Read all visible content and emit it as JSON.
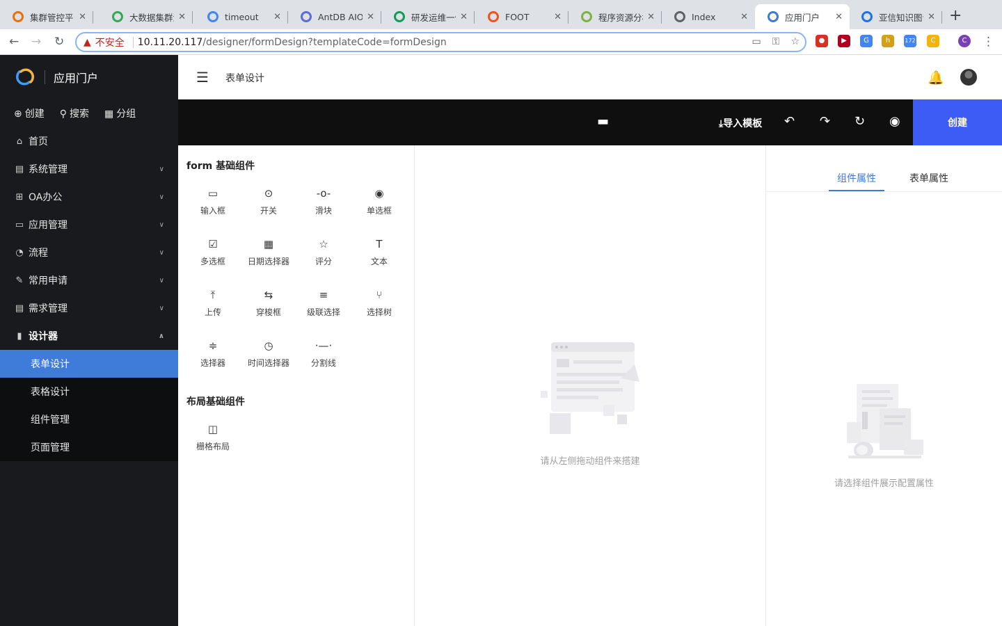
{
  "browser": {
    "tabs": [
      {
        "title": "集群管控平台",
        "color": "#e8710a"
      },
      {
        "title": "大数据集群滚",
        "color": "#34a853"
      },
      {
        "title": "timeout",
        "color": "#4285f4"
      },
      {
        "title": "AntDB AIOps",
        "color": "#5b6bd8"
      },
      {
        "title": "研发运维一体",
        "color": "#0f9d58"
      },
      {
        "title": "FOOT",
        "color": "#f4511e"
      },
      {
        "title": "程序资源分析",
        "color": "#7cb342"
      },
      {
        "title": "Index",
        "color": "#5f6368"
      },
      {
        "title": "应用门户",
        "color": "#3d7bd8"
      },
      {
        "title": "亚信知识图谱",
        "color": "#1a73e8"
      }
    ],
    "close_glyph": "✕",
    "newtab_glyph": "+",
    "insecure_label": "不安全",
    "url_host": "10.11.20.117",
    "url_path": "/designer/formDesign?templateCode=formDesign",
    "extensions": [
      {
        "name": "opera-ext-icon",
        "color": "#d93025",
        "text": "●"
      },
      {
        "name": "video-ext-icon",
        "color": "#b00020",
        "text": "▶"
      },
      {
        "name": "g-ext-icon",
        "color": "#4285f4",
        "text": "G"
      },
      {
        "name": "h-ext-icon",
        "color": "#d4a017",
        "text": "h"
      },
      {
        "name": "calendar-ext-icon",
        "color": "#4285f4",
        "text": "172"
      },
      {
        "name": "c-ext-icon",
        "color": "#f4b400",
        "text": "C"
      },
      {
        "name": "profile-ext-icon",
        "color": "#7b3fb8",
        "text": "C"
      }
    ]
  },
  "sidebar": {
    "brand": "应用门户",
    "quick": [
      {
        "icon": "plus-circle-icon",
        "glyph": "⊕",
        "label": "创建"
      },
      {
        "icon": "search-icon",
        "glyph": "⚲",
        "label": "搜索"
      },
      {
        "icon": "grid-icon",
        "glyph": "▦",
        "label": "分组"
      }
    ],
    "menu": [
      {
        "id": "home",
        "icon": "home-icon",
        "glyph": "⌂",
        "label": "首页",
        "chevron": ""
      },
      {
        "id": "system",
        "icon": "list-icon",
        "glyph": "▤",
        "label": "系统管理",
        "chevron": "∨"
      },
      {
        "id": "oa",
        "icon": "apps-icon",
        "glyph": "⊞",
        "label": "OA办公",
        "chevron": "∨"
      },
      {
        "id": "apps",
        "icon": "folder-icon",
        "glyph": "▭",
        "label": "应用管理",
        "chevron": "∨"
      },
      {
        "id": "flow",
        "icon": "dashboard-icon",
        "glyph": "◔",
        "label": "流程",
        "chevron": "∨"
      },
      {
        "id": "apply",
        "icon": "edit-icon",
        "glyph": "✎",
        "label": "常用申请",
        "chevron": "∨"
      },
      {
        "id": "demand",
        "icon": "doc-icon",
        "glyph": "▤",
        "label": "需求管理",
        "chevron": "∨"
      },
      {
        "id": "designer",
        "icon": "bar-chart-icon",
        "glyph": "▮",
        "label": "设计器",
        "chevron": "∧"
      }
    ],
    "submenu": [
      "表单设计",
      "表格设计",
      "组件管理",
      "页面管理"
    ]
  },
  "header": {
    "menu_glyph": "☰",
    "title": "表单设计",
    "bell_glyph": "🔔"
  },
  "toolbar": {
    "monitor_glyph": "▬",
    "import_label": "⤓导入模板",
    "undo_glyph": "↶",
    "redo_glyph": "↷",
    "refresh_glyph": "↻",
    "preview_glyph": "◉",
    "create_label": "创建"
  },
  "components": {
    "basic_title": "form 基础组件",
    "basic": [
      {
        "label": "输入框",
        "glyph": "▭",
        "icon": "input-icon"
      },
      {
        "label": "开关",
        "glyph": "⊙",
        "icon": "switch-icon"
      },
      {
        "label": "滑块",
        "glyph": "-o-",
        "icon": "slider-icon"
      },
      {
        "label": "单选框",
        "glyph": "◉",
        "icon": "radio-icon"
      },
      {
        "label": "多选框",
        "glyph": "☑",
        "icon": "checkbox-icon"
      },
      {
        "label": "日期选择器",
        "glyph": "▦",
        "icon": "calendar-icon"
      },
      {
        "label": "评分",
        "glyph": "☆",
        "icon": "star-icon"
      },
      {
        "label": "文本",
        "glyph": "T",
        "icon": "text-icon"
      },
      {
        "label": "上传",
        "glyph": "⤒",
        "icon": "upload-icon"
      },
      {
        "label": "穿梭框",
        "glyph": "⇆",
        "icon": "transfer-icon"
      },
      {
        "label": "级联选择",
        "glyph": "≡",
        "icon": "cascader-icon"
      },
      {
        "label": "选择树",
        "glyph": "⑂",
        "icon": "tree-select-icon"
      },
      {
        "label": "选择器",
        "glyph": "≑",
        "icon": "select-icon"
      },
      {
        "label": "时间选择器",
        "glyph": "◷",
        "icon": "clock-icon"
      },
      {
        "label": "分割线",
        "glyph": "·—·",
        "icon": "divider-icon"
      }
    ],
    "layout_title": "布局基础组件",
    "layout": [
      {
        "label": "栅格布局",
        "glyph": "◫",
        "icon": "grid-layout-icon"
      }
    ]
  },
  "canvas": {
    "empty_text": "请从左侧拖动组件来搭建"
  },
  "props": {
    "tabs": [
      "组件属性",
      "表单属性"
    ],
    "empty_text": "请选择组件展示配置属性"
  }
}
